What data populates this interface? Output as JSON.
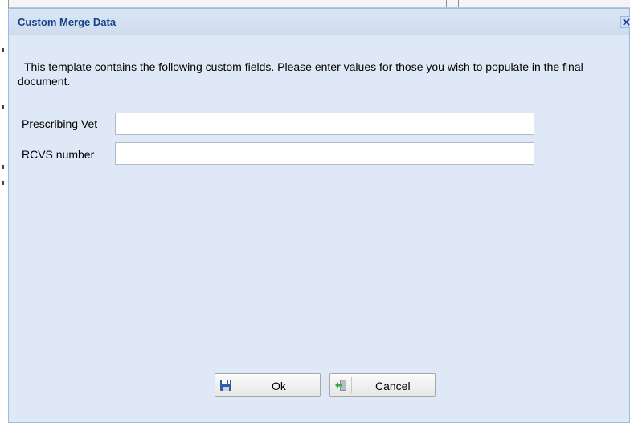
{
  "dialog": {
    "title": "Custom Merge Data",
    "intro": "This template contains the following custom fields. Please enter values for those you wish to populate   in the final document.",
    "fields": [
      {
        "label": "Prescribing Vet",
        "value": ""
      },
      {
        "label": "RCVS number",
        "value": ""
      }
    ],
    "buttons": {
      "ok": "Ok",
      "cancel": "Cancel"
    }
  },
  "icons": {
    "close": "close-icon",
    "ok": "save-disk-icon",
    "cancel": "exit-door-icon"
  },
  "colors": {
    "title_text": "#15428b",
    "dialog_bg": "#dfe8f6",
    "border": "#99bbe8"
  }
}
